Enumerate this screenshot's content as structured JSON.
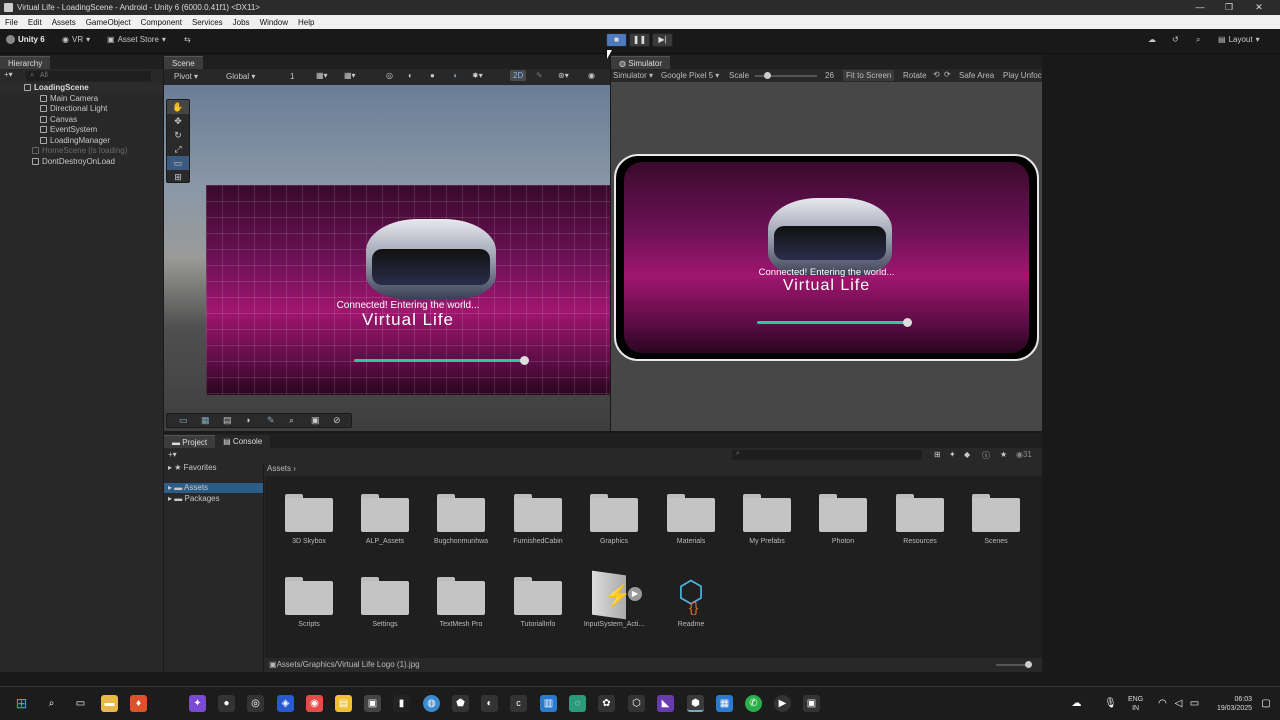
{
  "window": {
    "title": "Virtual Life - LoadingScene - Android - Unity 6 (6000.0.41f1) <DX11>",
    "minimize": "—",
    "maximize": "❐",
    "close": "✕"
  },
  "menu": [
    "File",
    "Edit",
    "Assets",
    "GameObject",
    "Component",
    "Services",
    "Jobs",
    "Window",
    "Help"
  ],
  "toolbar": {
    "account": "Unity 6",
    "vr": "VR",
    "asset_store": "Asset Store",
    "layout": "Layout"
  },
  "hierarchy": {
    "tab": "Hierarchy",
    "search_placeholder": "All",
    "items": [
      {
        "label": "LoadingScene",
        "level": 0
      },
      {
        "label": "Main Camera",
        "level": 2
      },
      {
        "label": "Directional Light",
        "level": 2
      },
      {
        "label": "Canvas",
        "level": 2
      },
      {
        "label": "EventSystem",
        "level": 2
      },
      {
        "label": "LoadingManager",
        "level": 2
      },
      {
        "label": "HomeScene (is loading)",
        "level": 0
      },
      {
        "label": "DontDestroyOnLoad",
        "level": 0
      }
    ]
  },
  "scene": {
    "tab": "Scene",
    "pivot": "Pivot",
    "global": "Global",
    "grid_value": "1",
    "mode_2d": "2D"
  },
  "simulator": {
    "tab": "Simulator",
    "mode": "Simulator",
    "device": "Google Pixel 5",
    "scale_label": "Scale",
    "scale_value": "26",
    "fit": "Fit to Screen",
    "rotate": "Rotate",
    "safe_area": "Safe Area",
    "play_unfocused": "Play Unfoc"
  },
  "game_screen": {
    "status": "Connected! Entering the world...",
    "title": "Virtual Life",
    "progress": 0.97
  },
  "project": {
    "tab_project": "Project",
    "tab_console": "Console",
    "favorites": "Favorites",
    "assets": "Assets",
    "packages": "Packages",
    "breadcrumb": "Assets",
    "count": "31",
    "folders": [
      "3D Skybox",
      "ALP_Assets",
      "Bugchonmunhwa",
      "FurnishedCabin",
      "Graphics",
      "Materials",
      "My Prefabs",
      "Photon",
      "Resources",
      "Scenes",
      "Scripts",
      "Settings",
      "TextMesh Pro",
      "TutorialInfo"
    ],
    "files": [
      "InputSystem_Acti...",
      "Readme"
    ],
    "selected_path": "Assets/Graphics/Virtual Life Logo (1).jpg"
  },
  "taskbar": {
    "lang": "ENG",
    "region": "IN",
    "time": "06:03",
    "date": "19/03/2025"
  }
}
